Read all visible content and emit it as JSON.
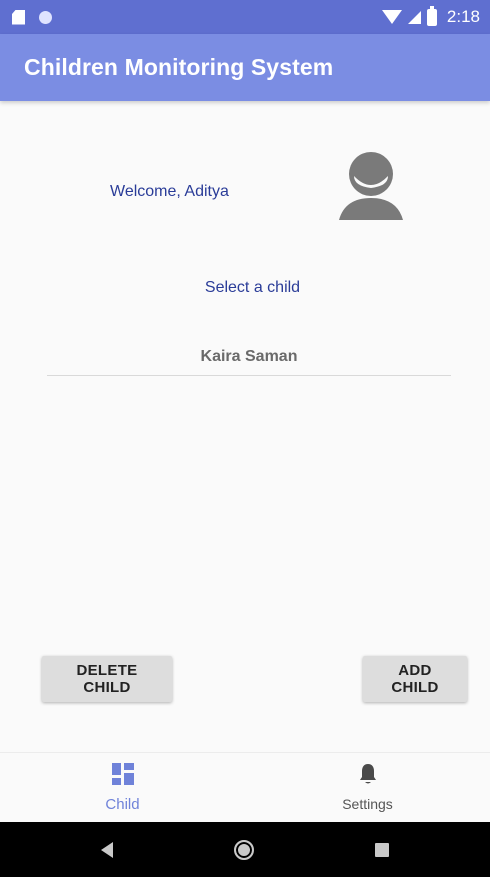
{
  "status_bar": {
    "time": "2:18"
  },
  "app_bar": {
    "title": "Children Monitoring System"
  },
  "main": {
    "welcome_text": "Welcome, Aditya",
    "select_label": "Select a child",
    "selected_child": "Kaira Saman"
  },
  "actions": {
    "delete_label": "DELETE CHILD",
    "add_label": "ADD CHILD"
  },
  "bottom_nav": {
    "items": [
      {
        "label": "Child",
        "icon": "dashboard-icon",
        "active": true
      },
      {
        "label": "Settings",
        "icon": "bell-icon",
        "active": false
      }
    ]
  },
  "system_nav": {
    "icons": [
      "back-icon",
      "home-icon",
      "recents-icon"
    ]
  },
  "colors": {
    "status_bar": "#5f6fd0",
    "app_bar": "#7b8de3",
    "accent_text": "#2a3c98",
    "nav_active": "#6f82d9"
  }
}
